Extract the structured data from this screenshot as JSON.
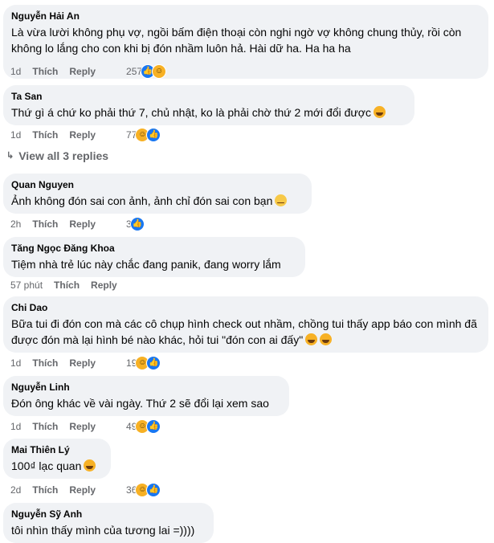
{
  "comments": [
    {
      "author": "Nguyễn Hải An",
      "text": "Là vừa lười không phụ vợ, ngồi bấm điện thoại còn nghi ngờ vợ không chung thủy, rồi còn không lo lắng cho con khi bị đón nhầm luôn hả. Hài dữ ha. Ha ha ha",
      "time": "1d",
      "like_label": "Thích",
      "reply_label": "Reply",
      "reaction_count": "257",
      "reactions": [
        "like-icon",
        "haha-icon"
      ]
    },
    {
      "author": "Ta San",
      "text": "Thứ gì á chứ ko phải thứ 7, chủ nhật, ko là phải chờ thứ 2 mới đổi được",
      "time": "1d",
      "like_label": "Thích",
      "reply_label": "Reply",
      "reaction_count": "77",
      "reactions": [
        "haha-icon",
        "like-icon"
      ]
    },
    {
      "author": "Quan Nguyen",
      "text": "Ảnh không đón sai con ảnh, ảnh chỉ đón sai con bạn",
      "time": "2h",
      "like_label": "Thích",
      "reply_label": "Reply",
      "reaction_count": "3",
      "reactions": [
        "like-icon"
      ]
    },
    {
      "author": "Tăng Ngọc Đăng Khoa",
      "text": "Tiệm nhà trẻ lúc này chắc đang panik, đang worry lắm",
      "time": "57 phút",
      "like_label": "Thích",
      "reply_label": "Reply"
    },
    {
      "author": "Chi Dao",
      "text": "Bữa tui đi đón con mà các cô chụp hình check out nhầm, chồng tui thấy app báo con mình đã được đón mà lại hình bé nào khác, hỏi tui \"đón con ai đấy\"",
      "time": "1d",
      "like_label": "Thích",
      "reply_label": "Reply",
      "reaction_count": "19",
      "reactions": [
        "haha-icon",
        "like-icon"
      ]
    },
    {
      "author": "Nguyễn Linh",
      "text": "Đón ông khác về vài ngày. Thứ 2 sẽ đổi lại xem sao",
      "time": "1d",
      "like_label": "Thích",
      "reply_label": "Reply",
      "reaction_count": "49",
      "reactions": [
        "haha-icon",
        "like-icon"
      ]
    },
    {
      "author": "Mai Thiên Lý",
      "text": "100₫ lạc quan",
      "time": "2d",
      "like_label": "Thích",
      "reply_label": "Reply",
      "reaction_count": "36",
      "reactions": [
        "haha-icon",
        "like-icon"
      ]
    },
    {
      "author": "Nguyễn Sỹ Anh",
      "text": "tôi nhìn thấy mình của tương lai =))))"
    }
  ],
  "view_replies_label": "View all 3 replies",
  "colors": {
    "bubble": "#f0f2f5",
    "meta": "#65676b",
    "like": "#1877f2",
    "haha": "#f7b125"
  }
}
